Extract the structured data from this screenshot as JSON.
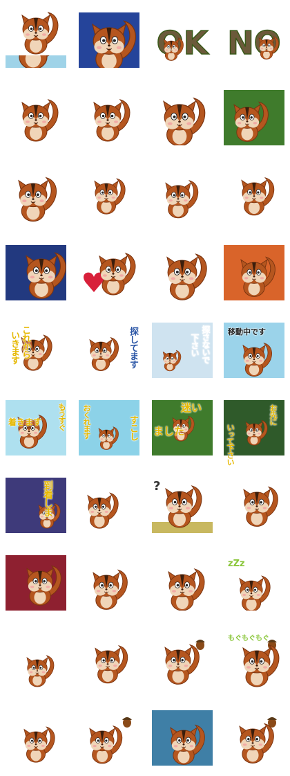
{
  "sheet": {
    "title": "",
    "stickers": [
      {
        "id": 1,
        "mood": "cheer",
        "text": "",
        "bg": "#9fd3e8"
      },
      {
        "id": 2,
        "mood": "sly",
        "text": "",
        "bg": "#25449a"
      },
      {
        "id": 3,
        "mood": "ok",
        "text": "OK",
        "bg": "#ffffff"
      },
      {
        "id": 4,
        "mood": "no",
        "text": "NO",
        "bg": "#ffffff"
      },
      {
        "id": 5,
        "mood": "flowers",
        "text": "",
        "bg": "#ffffff"
      },
      {
        "id": 6,
        "mood": "sneeze",
        "text": "",
        "bg": "#ffffff"
      },
      {
        "id": 7,
        "mood": "laugh",
        "text": "",
        "bg": "#ffffff"
      },
      {
        "id": 8,
        "mood": "tree",
        "text": "",
        "bg": "#3f7b2c"
      },
      {
        "id": 9,
        "mood": "mask",
        "text": "",
        "bg": "#ffffff"
      },
      {
        "id": 10,
        "mood": "dance",
        "text": "",
        "bg": "#ffffff"
      },
      {
        "id": 11,
        "mood": "angry",
        "text": "",
        "bg": "#ffffff"
      },
      {
        "id": 12,
        "mood": "cake",
        "text": "",
        "bg": "#ffffff"
      },
      {
        "id": 13,
        "mood": "flash",
        "text": "",
        "bg": "#22397f"
      },
      {
        "id": 14,
        "mood": "love",
        "text": "",
        "bg": "#ffffff"
      },
      {
        "id": 15,
        "mood": "sweat",
        "text": "",
        "bg": "#ffffff"
      },
      {
        "id": 16,
        "mood": "fire",
        "text": "",
        "bg": "#d9642a"
      },
      {
        "id": 17,
        "mood": "from-now",
        "text": "これから いきます",
        "bg": "#ffffff"
      },
      {
        "id": 18,
        "mood": "looking",
        "text": "探してます",
        "bg": "#ffffff"
      },
      {
        "id": 19,
        "mood": "search",
        "text": "探さないで下さい",
        "bg": "#cfe3f0"
      },
      {
        "id": 20,
        "mood": "moving",
        "text": "移動中です",
        "bg": "#9bd3ea"
      },
      {
        "id": 21,
        "mood": "arrive",
        "text": "もうすぐ 着きます",
        "bg": "#aee0ef"
      },
      {
        "id": 22,
        "mood": "late",
        "text": "おくれます",
        "bg": "#8cd2e8"
      },
      {
        "id": 23,
        "mood": "little",
        "text": "すこし",
        "bg": "#3f7b2c"
      },
      {
        "id": 24,
        "mood": "lost",
        "text": "迷いました",
        "bg": "#2f5a2a"
      },
      {
        "id": 25,
        "mood": "go-ahead",
        "text": "お先に いって下さい",
        "bg": "#3e3a7a"
      },
      {
        "id": 26,
        "mood": "arrived",
        "text": "到着しま",
        "bg": "#ffffff"
      },
      {
        "id": 27,
        "mood": "tea",
        "text": "",
        "bg": "#ffffff"
      },
      {
        "id": 28,
        "mood": "question",
        "text": "?",
        "bg": "#ffffff"
      },
      {
        "id": 29,
        "mood": "curtain",
        "text": "",
        "bg": "#8e2030"
      },
      {
        "id": 30,
        "mood": "sleepy",
        "text": "",
        "bg": "#ffffff"
      },
      {
        "id": 31,
        "mood": "yawn",
        "text": "",
        "bg": "#ffffff"
      },
      {
        "id": 32,
        "mood": "relax",
        "text": "",
        "bg": "#ffffff"
      },
      {
        "id": 33,
        "mood": "z",
        "text": "zZz",
        "bg": "#ffffff"
      },
      {
        "id": 34,
        "mood": "shock",
        "text": "",
        "bg": "#ffffff"
      },
      {
        "id": 35,
        "mood": "acorn",
        "text": "",
        "bg": "#ffffff"
      },
      {
        "id": 36,
        "mood": "eat",
        "text": "",
        "bg": "#ffffff"
      },
      {
        "id": 37,
        "mood": "munch",
        "text": "もぐもぐもぐ",
        "bg": "#ffffff"
      },
      {
        "id": 38,
        "mood": "fluffy",
        "text": "",
        "bg": "#ffffff"
      },
      {
        "id": 39,
        "mood": "rain",
        "text": "",
        "bg": "#3f7fa6"
      },
      {
        "id": 40,
        "mood": "acorn-hat",
        "text": "",
        "bg": "#ffffff"
      },
      {
        "id": 41,
        "mood": "shy",
        "text": "",
        "bg": "#ffffff"
      }
    ]
  },
  "captions": {
    "ok": "OK",
    "no": "NO",
    "korekara": "これから",
    "ikimasu": "いきます",
    "sagashitemasu": "探してます",
    "sagasanaide": "探さないで",
    "kudasai": "下さい",
    "idouchu": "移動中です",
    "mousugu": "もうすぐ",
    "tsukimasu": "着きます",
    "okuremasu": "おくれます",
    "sukoshi": "すこし",
    "mayoi": "迷い",
    "mashita": "ました",
    "osakini": "お先に",
    "itte": "いって下さい",
    "touchaku": "到着しま",
    "question": "?",
    "zzz": "zZz",
    "mogu": "もぐもぐもぐ"
  },
  "palette": {
    "fur": "#b5561f",
    "fur_dark": "#7a3410",
    "fur_light": "#f0d5b8",
    "stripe": "#3b1e0c",
    "blush": "#f3a0a0",
    "caption_yellow": "#e6b800",
    "caption_white": "#ffffff",
    "caption_blue": "#2b56a6"
  }
}
